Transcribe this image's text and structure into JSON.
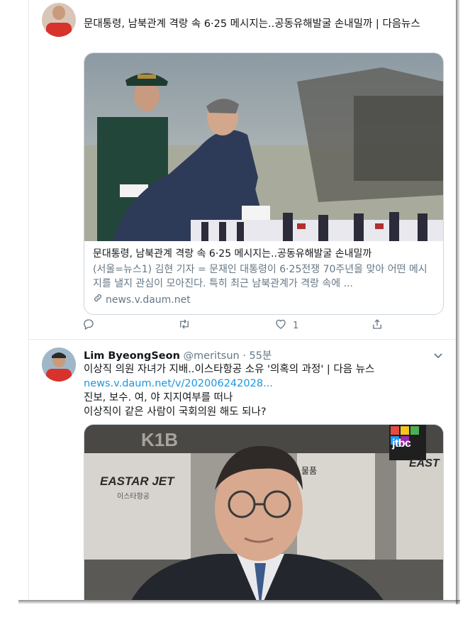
{
  "tweet1": {
    "text": "문대통령, 남북관계 격랑 속 6·25 메시지는..공동유해발굴 손내밀까 | 다음뉴스",
    "card": {
      "title": "문대통령, 남북관계 격랑 속 6·25 메시지는..공동유해발굴 손내밀까",
      "description": "(서울=뉴스1) 김현 기자 = 문재인 대통령이 6·25전쟁 70주년을 맞아 어떤 메시지를 낼지 관심이 모아진다. 특히 최근 남북관계가 격랑 속에 ...",
      "domain": "news.v.daum.net"
    },
    "actions": {
      "reply_count": "",
      "retweet_count": "",
      "like_count": "1"
    }
  },
  "tweet2": {
    "display_name": "Lim ByeongSeon",
    "handle": "@meritsun",
    "separator": "·",
    "time": "55분",
    "line1": "이상직 의원 자녀가 지배..이스타항공 소유 '의혹의 과정' | 다음 뉴스",
    "link": "news.v.daum.net/v/202006242028...",
    "line2": "진보, 보수. 여, 야 지지여부를 떠나",
    "line3": "이상직이 같은 사람이 국회의원 해도 되나?",
    "image": {
      "sign_brand": "EASTAR JET",
      "sign_brand_kr": "이스타항공",
      "sign_code": "K1B",
      "sign_text": "물품",
      "sign_brand_right": "EAST",
      "broadcaster_logo": "jtbc"
    }
  },
  "colors": {
    "link": "#1b95e0",
    "text": "#14171a",
    "muted": "#657786",
    "border": "#ccd6dd"
  }
}
